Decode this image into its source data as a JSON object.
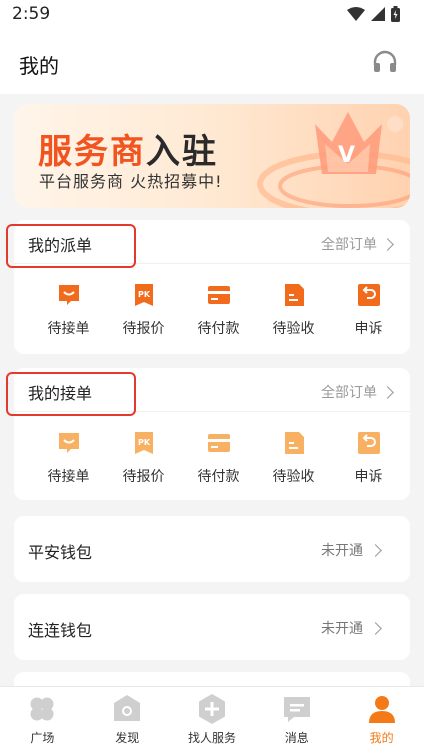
{
  "status_bar": {
    "time": "2:59"
  },
  "header": {
    "title": "我的",
    "support_icon": "headset-icon"
  },
  "banner": {
    "title_accent": "服务商",
    "title_rest": "入驻",
    "subtitle": "平台服务商 火热招募中!"
  },
  "dispatch_orders": {
    "title": "我的派单",
    "link": "全部订单",
    "items": [
      {
        "label": "待接单",
        "icon": "pending-accept-icon"
      },
      {
        "label": "待报价",
        "icon": "pk-quote-icon"
      },
      {
        "label": "待付款",
        "icon": "card-payment-icon"
      },
      {
        "label": "待验收",
        "icon": "note-inspect-icon"
      },
      {
        "label": "申诉",
        "icon": "appeal-return-icon"
      }
    ]
  },
  "received_orders": {
    "title": "我的接单",
    "link": "全部订单",
    "items": [
      {
        "label": "待接单",
        "icon": "pending-accept-icon"
      },
      {
        "label": "待报价",
        "icon": "pk-quote-icon"
      },
      {
        "label": "待付款",
        "icon": "card-payment-icon"
      },
      {
        "label": "待验收",
        "icon": "note-inspect-icon"
      },
      {
        "label": "申诉",
        "icon": "appeal-return-icon"
      }
    ]
  },
  "wallets": [
    {
      "title": "平安钱包",
      "status": "未开通"
    },
    {
      "title": "连连钱包",
      "status": "未开通"
    }
  ],
  "tabbar": {
    "tabs": [
      {
        "label": "广场",
        "icon": "clover-icon"
      },
      {
        "label": "发现",
        "icon": "discover-icon"
      },
      {
        "label": "找人服务",
        "icon": "plus-hex-icon"
      },
      {
        "label": "消息",
        "icon": "message-icon"
      },
      {
        "label": "我的",
        "icon": "user-icon"
      }
    ],
    "active": "我的"
  },
  "colors": {
    "accent": "#f37a17",
    "highlight": "#e23b2e",
    "icon_dispatch": "#f26b1d",
    "icon_received": "#f8b062"
  }
}
